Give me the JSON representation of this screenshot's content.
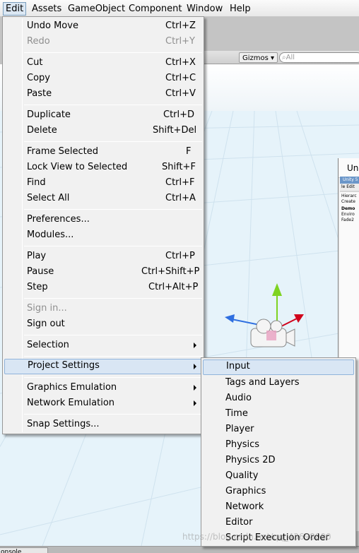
{
  "menubar": {
    "items": [
      {
        "label": "Edit",
        "active": true
      },
      {
        "label": "Assets"
      },
      {
        "label": "GameObject"
      },
      {
        "label": "Component"
      },
      {
        "label": "Window"
      },
      {
        "label": "Help"
      }
    ]
  },
  "scene": {
    "gizmos_label": "Gizmos ▾",
    "search_placeholder": "All",
    "console_tab": "onsole"
  },
  "mini_window": {
    "title": "Unity",
    "inner_tab_1": "Unity 5",
    "inner_tab_2": "le Edit",
    "hierarchy_label": "Hierarc",
    "create_label": "Create",
    "demo_label": "Demo",
    "environ_label": "Enviro",
    "fade_label": "Fade2"
  },
  "edit_menu": {
    "items": [
      {
        "label": "Undo Move",
        "shortcut": "Ctrl+Z"
      },
      {
        "label": "Redo",
        "shortcut": "Ctrl+Y",
        "disabled": true
      },
      {
        "label": "Cut",
        "shortcut": "Ctrl+X"
      },
      {
        "label": "Copy",
        "shortcut": "Ctrl+C"
      },
      {
        "label": "Paste",
        "shortcut": "Ctrl+V"
      },
      {
        "label": "Duplicate",
        "shortcut": "Ctrl+D"
      },
      {
        "label": "Delete",
        "shortcut": "Shift+Del"
      },
      {
        "label": "Frame Selected",
        "shortcut": "F"
      },
      {
        "label": "Lock View to Selected",
        "shortcut": "Shift+F"
      },
      {
        "label": "Find",
        "shortcut": "Ctrl+F"
      },
      {
        "label": "Select All",
        "shortcut": "Ctrl+A"
      },
      {
        "label": "Preferences..."
      },
      {
        "label": "Modules..."
      },
      {
        "label": "Play",
        "shortcut": "Ctrl+P"
      },
      {
        "label": "Pause",
        "shortcut": "Ctrl+Shift+P"
      },
      {
        "label": "Step",
        "shortcut": "Ctrl+Alt+P"
      },
      {
        "label": "Sign in...",
        "disabled": true
      },
      {
        "label": "Sign out"
      },
      {
        "label": "Selection",
        "submenu": true
      },
      {
        "label": "Project Settings",
        "submenu": true,
        "highlight": true
      },
      {
        "label": "Graphics Emulation",
        "submenu": true
      },
      {
        "label": "Network Emulation",
        "submenu": true
      },
      {
        "label": "Snap Settings..."
      }
    ]
  },
  "project_settings_menu": {
    "items": [
      {
        "label": "Input",
        "highlight": true
      },
      {
        "label": "Tags and Layers"
      },
      {
        "label": "Audio"
      },
      {
        "label": "Time"
      },
      {
        "label": "Player"
      },
      {
        "label": "Physics"
      },
      {
        "label": "Physics 2D"
      },
      {
        "label": "Quality"
      },
      {
        "label": "Graphics"
      },
      {
        "label": "Network"
      },
      {
        "label": "Editor"
      },
      {
        "label": "Script Execution Order"
      }
    ]
  },
  "watermark": "https://blog.csdn.net/qq_43698000",
  "colors": {
    "highlight": "#d9e6f4",
    "highlight_border": "#8fb3da",
    "gizmo_y": "#7ed321",
    "gizmo_x": "#d0021b",
    "gizmo_z": "#2f6fe0"
  }
}
